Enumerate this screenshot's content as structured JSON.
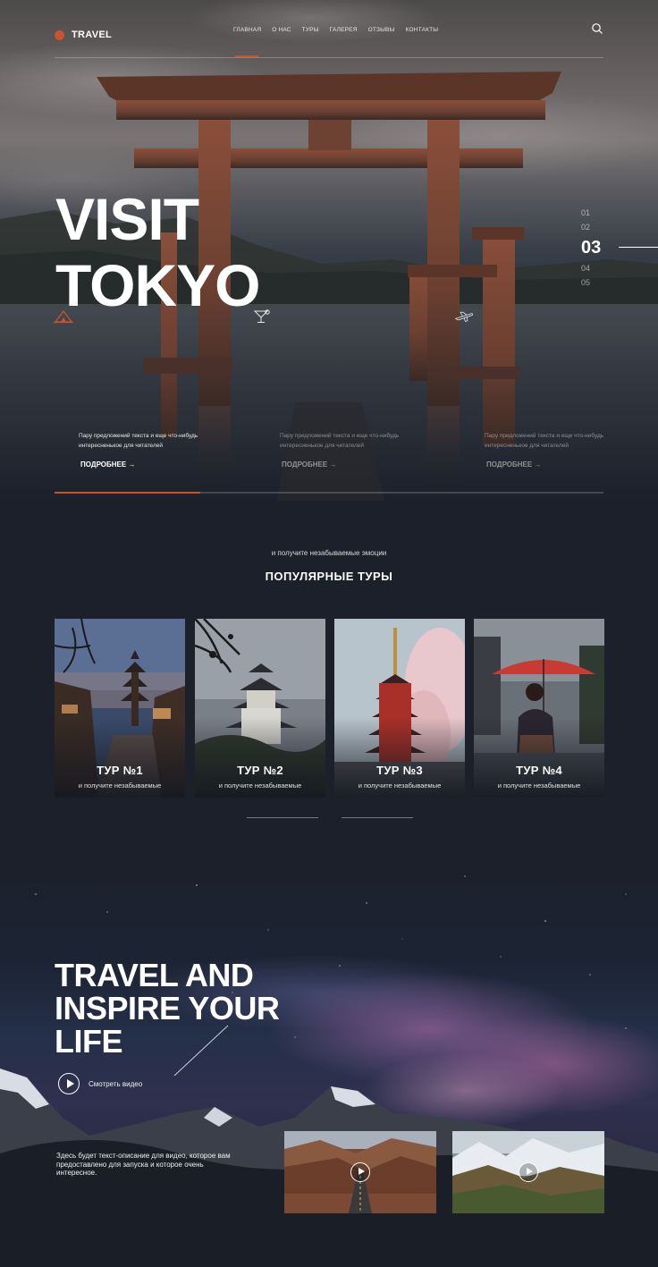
{
  "nav": {
    "logo": "TRAVEL",
    "menu": [
      "ГЛАВНАЯ",
      "О НАС",
      "ТУРЫ",
      "ГАЛЕРЕЯ",
      "ОТЗЫВЫ",
      "КОНТАКТЫ"
    ],
    "accent": "#c8532c"
  },
  "hero": {
    "title_line1": "VISIT",
    "title_line2": "TOKYO",
    "slides": [
      "01",
      "02",
      "03",
      "04",
      "05"
    ],
    "active_slide": "03",
    "columns": [
      {
        "text": "Пару предложений текста и еще что-нибудь интересненькое для читателей",
        "more": "ПОДРОБНЕЕ →",
        "icon": "camping-tent-icon"
      },
      {
        "text": "Пару предложений текста и еще что-нибудь интересненькое для читателей",
        "more": "ПОДРОБНЕЕ →",
        "icon": "cocktail-icon"
      },
      {
        "text": "Пару предложений текста и еще что-нибудь интересненькое для читателей",
        "more": "ПОДРОБНЕЕ →",
        "icon": "airplane-icon"
      }
    ],
    "progress_fraction": 0.265
  },
  "tours": {
    "subtitle": "и получите незабываемые эмоции",
    "title": "ПОПУЛЯРНЫЕ ТУРЫ",
    "cards": [
      {
        "title": "ТУР №1",
        "subtitle": "и получите незабываемые"
      },
      {
        "title": "ТУР №2",
        "subtitle": "и получите незабываемые"
      },
      {
        "title": "ТУР №3",
        "subtitle": "и получите незабываемые"
      },
      {
        "title": "ТУР №4",
        "subtitle": "и получите незабываемые"
      }
    ]
  },
  "video": {
    "title_line1": "TRAVEL AND",
    "title_line2": "INSPIRE YOUR",
    "title_line3": "LIFE",
    "watch_label": "Смотреть видео",
    "description": "Здесь будет текст-описание для видео, которое вам предоставлено для запуска и которое очень интересное."
  }
}
